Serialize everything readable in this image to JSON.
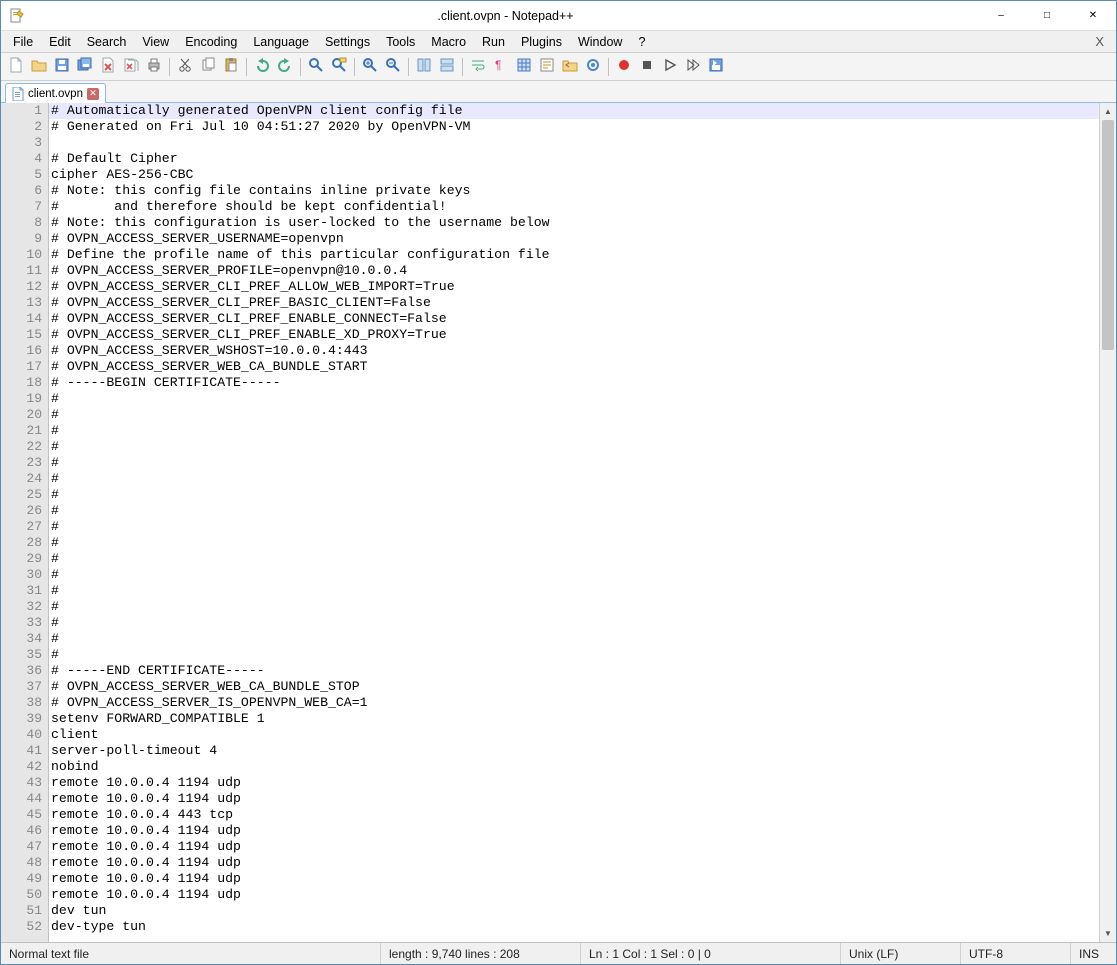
{
  "title": ".client.ovpn - Notepad++",
  "menu": [
    "File",
    "Edit",
    "Search",
    "View",
    "Encoding",
    "Language",
    "Settings",
    "Tools",
    "Macro",
    "Run",
    "Plugins",
    "Window",
    "?"
  ],
  "menu_x": "X",
  "tab": {
    "label": "client.ovpn"
  },
  "toolbar_icons": [
    "new-file",
    "open-file",
    "save",
    "save-all",
    "close",
    "close-all",
    "print",
    "sep",
    "cut",
    "copy",
    "paste",
    "sep",
    "undo",
    "redo",
    "sep",
    "find",
    "replace",
    "sep",
    "zoom-in",
    "zoom-out",
    "sep",
    "sync-v",
    "sync-h",
    "sep",
    "wrap",
    "all-chars",
    "indent-guide",
    "lang",
    "doc-dir",
    "monitor",
    "sep",
    "record",
    "stop",
    "play",
    "play-multi",
    "save-macro"
  ],
  "lines": [
    "# Automatically generated OpenVPN client config file",
    "# Generated on Fri Jul 10 04:51:27 2020 by OpenVPN-VM",
    "",
    "# Default Cipher",
    "cipher AES-256-CBC",
    "# Note: this config file contains inline private keys",
    "#       and therefore should be kept confidential!",
    "# Note: this configuration is user-locked to the username below",
    "# OVPN_ACCESS_SERVER_USERNAME=openvpn",
    "# Define the profile name of this particular configuration file",
    "# OVPN_ACCESS_SERVER_PROFILE=openvpn@10.0.0.4",
    "# OVPN_ACCESS_SERVER_CLI_PREF_ALLOW_WEB_IMPORT=True",
    "# OVPN_ACCESS_SERVER_CLI_PREF_BASIC_CLIENT=False",
    "# OVPN_ACCESS_SERVER_CLI_PREF_ENABLE_CONNECT=False",
    "# OVPN_ACCESS_SERVER_CLI_PREF_ENABLE_XD_PROXY=True",
    "# OVPN_ACCESS_SERVER_WSHOST=10.0.0.4:443",
    "# OVPN_ACCESS_SERVER_WEB_CA_BUNDLE_START",
    "# -----BEGIN CERTIFICATE-----",
    "# ",
    "# ",
    "# ",
    "# ",
    "# ",
    "# ",
    "# ",
    "# ",
    "# ",
    "# ",
    "# ",
    "# ",
    "# ",
    "# ",
    "# ",
    "# ",
    "# ",
    "# -----END CERTIFICATE-----",
    "# OVPN_ACCESS_SERVER_WEB_CA_BUNDLE_STOP",
    "# OVPN_ACCESS_SERVER_IS_OPENVPN_WEB_CA=1",
    "setenv FORWARD_COMPATIBLE 1",
    "client",
    "server-poll-timeout 4",
    "nobind",
    "remote 10.0.0.4 1194 udp",
    "remote 10.0.0.4 1194 udp",
    "remote 10.0.0.4 443 tcp",
    "remote 10.0.0.4 1194 udp",
    "remote 10.0.0.4 1194 udp",
    "remote 10.0.0.4 1194 udp",
    "remote 10.0.0.4 1194 udp",
    "remote 10.0.0.4 1194 udp",
    "dev tun",
    "dev-type tun"
  ],
  "status": {
    "filetype": "Normal text file",
    "length": "length : 9,740    lines : 208",
    "pos": "Ln : 1    Col : 1    Sel : 0 | 0",
    "eol": "Unix (LF)",
    "enc": "UTF-8",
    "ins": "INS"
  }
}
